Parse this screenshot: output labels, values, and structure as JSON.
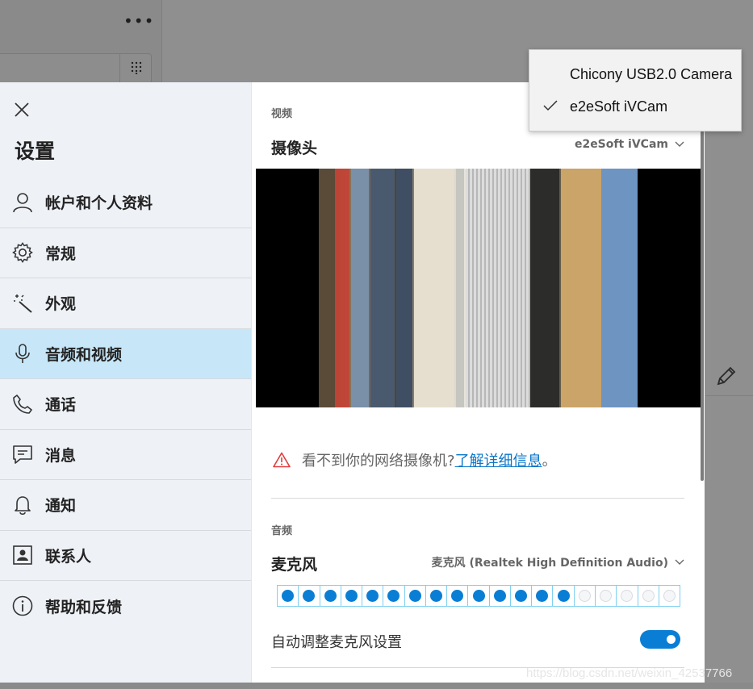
{
  "background": {
    "more_menu_glyph": "•••",
    "watermark": "https://blog.csdn.net/weixin_42537766"
  },
  "sidebar": {
    "title": "设置",
    "items": [
      {
        "label": "帐户和个人资料",
        "icon": "person-icon"
      },
      {
        "label": "常规",
        "icon": "gear-icon"
      },
      {
        "label": "外观",
        "icon": "magic-wand-icon"
      },
      {
        "label": "音频和视频",
        "icon": "microphone-icon",
        "active": true
      },
      {
        "label": "通话",
        "icon": "phone-icon"
      },
      {
        "label": "消息",
        "icon": "message-icon"
      },
      {
        "label": "通知",
        "icon": "bell-icon"
      },
      {
        "label": "联系人",
        "icon": "contact-card-icon"
      },
      {
        "label": "帮助和反馈",
        "icon": "info-icon"
      }
    ]
  },
  "video": {
    "section_label": "视频",
    "camera_label": "摄像头",
    "camera_selected": "e2eSoft iVCam",
    "warning_text": "看不到你的网络摄像机? ",
    "warning_link": "了解详细信息",
    "warning_end": "。"
  },
  "audio": {
    "section_label": "音频",
    "mic_label": "麦克风",
    "mic_selected": "麦克风 (Realtek High Definition Audio)",
    "meter_level": 0.7368,
    "meter_segments": 19,
    "auto_adjust_label": "自动调整麦克风设置",
    "auto_adjust_on": true
  },
  "camera_menu": {
    "options": [
      {
        "label": "Chicony USB2.0 Camera",
        "checked": false
      },
      {
        "label": "e2eSoft iVCam",
        "checked": true
      }
    ]
  },
  "colors": {
    "accent": "#0a7ed4",
    "active_nav": "#c7e7f8",
    "link": "#0a76c8",
    "warning": "#e23b3b"
  }
}
